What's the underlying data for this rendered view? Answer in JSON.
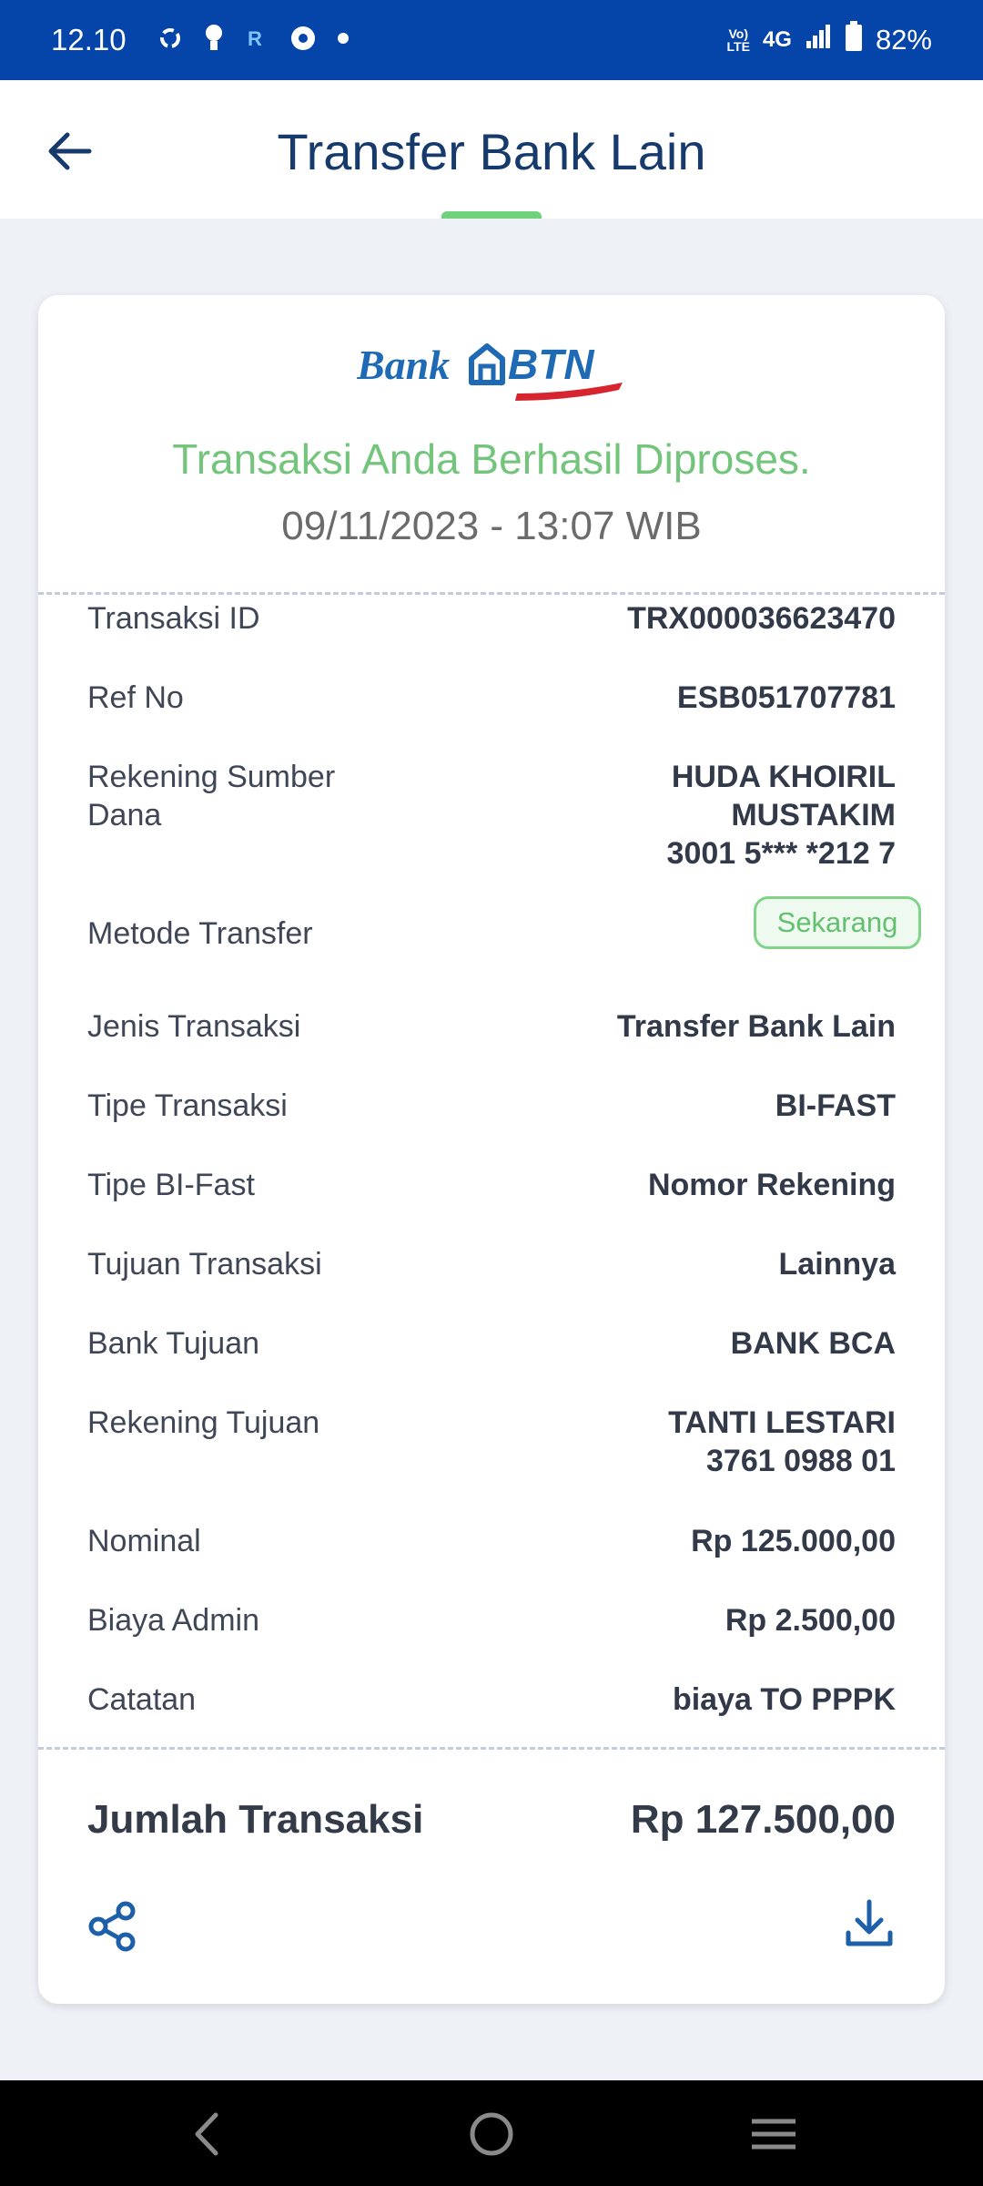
{
  "status_bar": {
    "time": "12.10",
    "volte": "Vo)\nLTE",
    "network": "4G",
    "battery": "82%",
    "icons": [
      "sync-icon",
      "bulb-icon",
      "r-app-icon",
      "chrome-icon",
      "dot-icon",
      "signal-icon",
      "battery-icon"
    ]
  },
  "header": {
    "title": "Transfer Bank Lain",
    "back_icon": "arrow-left-icon"
  },
  "receipt": {
    "logo_text": "Bank BTN",
    "status_message": "Transaksi Anda Berhasil Diproses.",
    "datetime": "09/11/2023 - 13:07 WIB",
    "rows": [
      {
        "label": "Transaksi ID",
        "value": "TRX000036623470"
      },
      {
        "label": "Ref No",
        "value": "ESB051707781"
      },
      {
        "label": "Rekening Sumber Dana",
        "value": "HUDA KHOIRIL MUSTAKIM",
        "value2": "3001 5*** *212 7"
      },
      {
        "label": "Metode Transfer",
        "value": "Sekarang"
      },
      {
        "label": "Jenis Transaksi",
        "value": "Transfer Bank Lain"
      },
      {
        "label": "Tipe Transaksi",
        "value": "BI-FAST"
      },
      {
        "label": "Tipe BI-Fast",
        "value": "Nomor Rekening"
      },
      {
        "label": "Tujuan Transaksi",
        "value": "Lainnya"
      },
      {
        "label": "Bank Tujuan",
        "value": "BANK BCA"
      },
      {
        "label": "Rekening Tujuan",
        "value": "TANTI LESTARI",
        "value2": "3761 0988 01"
      },
      {
        "label": "Nominal",
        "value": "Rp 125.000,00"
      },
      {
        "label": "Biaya Admin",
        "value": "Rp 2.500,00"
      },
      {
        "label": "Catatan",
        "value": "biaya TO PPPK"
      }
    ],
    "total_label": "Jumlah Transaksi",
    "total_value": "Rp 127.500,00",
    "actions": {
      "share_icon": "share-icon",
      "download_icon": "download-icon"
    }
  },
  "colors": {
    "status_bar": "#0544a8",
    "title": "#163a6b",
    "success": "#74c57c",
    "brand_blue": "#1f6ab5",
    "brand_red": "#d6252f"
  },
  "nav_bar": {
    "icons": [
      "nav-back-icon",
      "nav-home-icon",
      "nav-recents-icon"
    ]
  }
}
